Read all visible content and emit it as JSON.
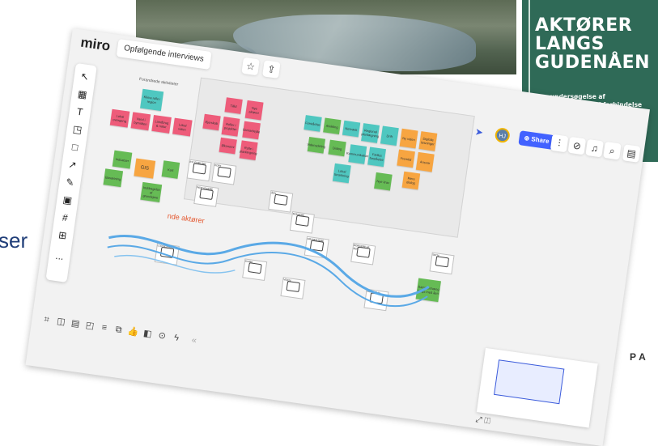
{
  "slide": {
    "title_lines": "AKTØRER\nLANGS\nGUDENÅEN",
    "subtitle": "- en undersøgelse af\naktørperspektiver i forbindelse\nmed klimatilpasning af Gudenåe",
    "left_fragment": "ser",
    "right_fragment": "PA",
    "colors": {
      "panel": "#2f6a57",
      "left_text": "#1f3d78"
    }
  },
  "miro": {
    "logo": "miro",
    "board_title": "Opfølgende interviews",
    "avatar_initials": "HJ",
    "share_label": "Share",
    "top_icons": [
      "star-icon",
      "upload-icon",
      "filter-icon",
      "timer-icon",
      "bell-icon",
      "search-icon",
      "notes-icon"
    ],
    "top_icon_glyphs": [
      "☆",
      "⇪",
      "⫶",
      "⊘",
      "♫",
      "⌕",
      "▤"
    ],
    "top_icon_badge": "9",
    "left_tools": [
      "↖",
      "▦",
      "T",
      "◳",
      "□",
      "↗",
      "✎",
      "▣",
      "#",
      "⊞",
      "..."
    ],
    "left_tool_names": [
      "select-icon",
      "templates-icon",
      "text-icon",
      "sticky-note-icon",
      "shape-icon",
      "arrow-icon",
      "pen-icon",
      "comment-icon",
      "frame-icon",
      "upload-icon",
      "more-icon"
    ],
    "bottom_tools": [
      "⌗",
      "◫",
      "▤",
      "◰",
      "≡",
      "⧉",
      "👍",
      "◧",
      "⊙",
      "ϟ",
      "«"
    ],
    "bottom_tool_names": [
      "frames-icon",
      "present-icon",
      "notes-icon",
      "cards-icon",
      "list-icon",
      "copy-icon",
      "vote-icon",
      "video-icon",
      "timer-icon",
      "activity-icon",
      "collapse-icon"
    ],
    "minimap_controls": "⤢  ◫",
    "frame_title": "Forandrede aktiviteter",
    "sticky_notes": [
      {
        "text": "Klima rolle i region",
        "color": "teal"
      },
      {
        "text": "Lokal overgang",
        "color": "pink"
      },
      {
        "text": "Vand i bymidten",
        "color": "pink"
      },
      {
        "text": "Landbrug & natur",
        "color": "pink"
      },
      {
        "text": "Lokal viden",
        "color": "pink"
      },
      {
        "text": "Tillid",
        "color": "pink"
      },
      {
        "text": "Nye aktører",
        "color": "pink"
      },
      {
        "text": "Ejerskab",
        "color": "pink"
      },
      {
        "text": "Roller i projekter",
        "color": "pink"
      },
      {
        "text": "Samarbejde",
        "color": "pink"
      },
      {
        "text": "Økonomi",
        "color": "pink"
      },
      {
        "text": "Rolle i planlægning",
        "color": "pink"
      },
      {
        "text": "Forståelse",
        "color": "teal"
      },
      {
        "text": "Afvikling",
        "color": "green"
      },
      {
        "text": "Netværk",
        "color": "teal"
      },
      {
        "text": "Regional planlægning",
        "color": "teal"
      },
      {
        "text": "Drift",
        "color": "teal"
      },
      {
        "text": "Vidensdeling",
        "color": "green"
      },
      {
        "text": "Dialog",
        "color": "green"
      },
      {
        "text": "Kommunikation",
        "color": "teal"
      },
      {
        "text": "Fælles forståelse",
        "color": "teal"
      },
      {
        "text": "Lokal forankring",
        "color": "teal"
      },
      {
        "text": "Ny viden",
        "color": "orange"
      },
      {
        "text": "Digitale løsninger",
        "color": "orange"
      },
      {
        "text": "Fremtid",
        "color": "orange"
      },
      {
        "text": "Ansvar",
        "color": "orange"
      },
      {
        "text": "Mere dialog",
        "color": "orange"
      },
      {
        "text": "Nye krav",
        "color": "green"
      },
      {
        "text": "GIS",
        "color": "orange"
      },
      {
        "text": "Indsatser",
        "color": "green"
      },
      {
        "text": "Bosætning",
        "color": "green"
      },
      {
        "text": "Kort",
        "color": "green"
      },
      {
        "text": "Inddragelse af grundejere",
        "color": "green"
      },
      {
        "text": "Sammenhæng langs med åen",
        "color": "green"
      }
    ],
    "drawings": [
      {
        "label": "BYUDVIKLING"
      },
      {
        "label": "KORT"
      },
      {
        "label": "INDBYGGERE"
      },
      {
        "label": "ÅEN"
      },
      {
        "label": "BEBOERE"
      },
      {
        "label": "GRUNDEJERE"
      },
      {
        "label": "BORGERE AF ÅEN"
      },
      {
        "label": "LODSEJERE"
      },
      {
        "label": "SKOV"
      },
      {
        "label": "LANDBRUG"
      },
      {
        "label": "VIDEN"
      },
      {
        "label": "KLIMA"
      }
    ],
    "river_label": "nde aktører"
  }
}
